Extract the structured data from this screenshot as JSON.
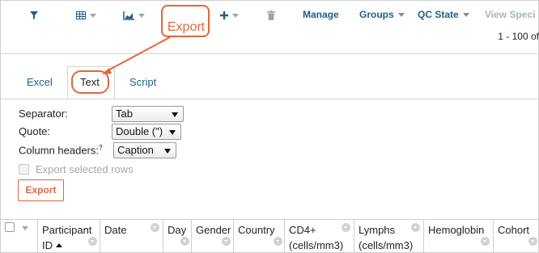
{
  "toolbar": {
    "icons": [
      "filter-icon",
      "grid-icon",
      "chart-icon",
      "download-icon",
      "plus-icon",
      "trash-icon"
    ],
    "manage_label": "Manage",
    "groups_label": "Groups",
    "qc_state_label": "QC State",
    "view_specimens_label": "View Speci",
    "pager_text": "1 - 100 of",
    "accent_color": "#1f5f8b",
    "muted_color": "#a9b4bd"
  },
  "callout": {
    "label": "Export",
    "color": "#e0683a"
  },
  "tabs": [
    {
      "label": "Excel",
      "active": false
    },
    {
      "label": "Text",
      "active": true
    },
    {
      "label": "Script",
      "active": false
    }
  ],
  "form": {
    "separator": {
      "label": "Separator:",
      "value": "Tab"
    },
    "quote": {
      "label": "Quote:",
      "value": "Double (\")"
    },
    "column_headers": {
      "label": "Column headers:",
      "help_mark": "?",
      "value": "Caption"
    },
    "export_selected": {
      "label": "Export selected rows",
      "checked": false,
      "disabled": true
    },
    "export_button": "Export"
  },
  "grid": {
    "columns": [
      {
        "line1": "Participant",
        "line2": "ID",
        "sorted": "asc"
      },
      {
        "line1": "Date",
        "line2": ""
      },
      {
        "line1": "Day",
        "line2": ""
      },
      {
        "line1": "Gender",
        "line2": ""
      },
      {
        "line1": "Country",
        "line2": ""
      },
      {
        "line1": "CD4+",
        "line2": "(cells/mm3)"
      },
      {
        "line1": "Lymphs",
        "line2": "(cells/mm3)"
      },
      {
        "line1": "Hemoglobin",
        "line2": ""
      },
      {
        "line1": "Cohort",
        "line2": ""
      }
    ]
  }
}
